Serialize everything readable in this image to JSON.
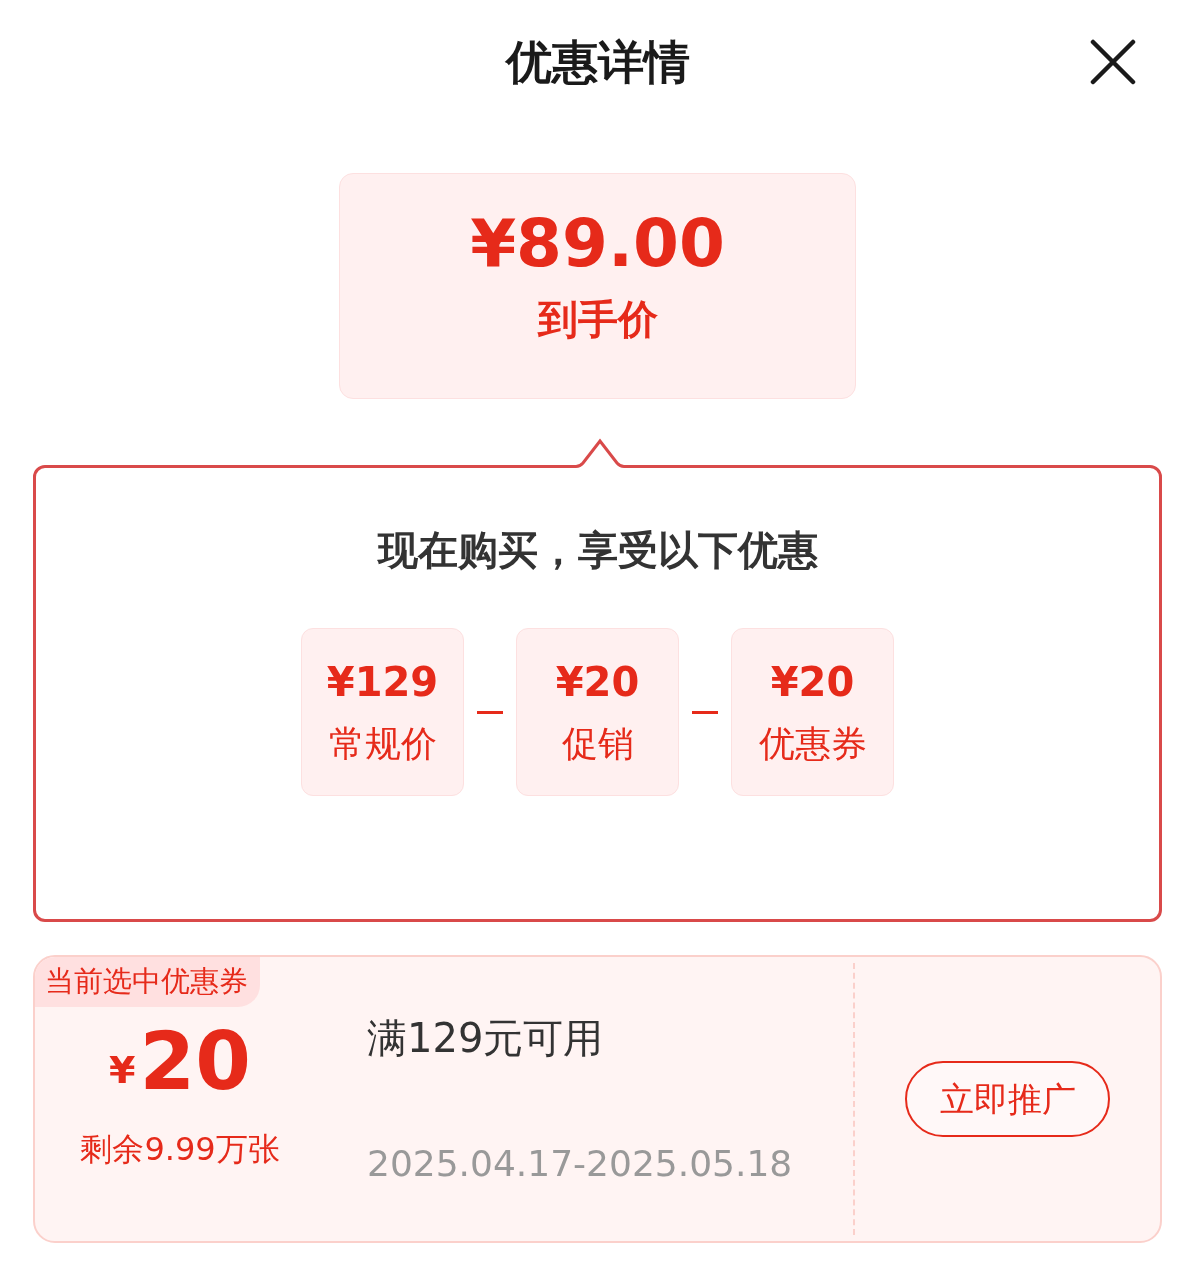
{
  "header": {
    "title": "优惠详情"
  },
  "final_price": {
    "amount": "¥89.00",
    "label": "到手价"
  },
  "breakdown": {
    "heading": "现在购买，享受以下优惠",
    "items": [
      {
        "amount": "¥129",
        "label": "常规价"
      },
      {
        "amount": "¥20",
        "label": "促销"
      },
      {
        "amount": "¥20",
        "label": "优惠券"
      }
    ]
  },
  "coupon": {
    "tag": "当前选中优惠券",
    "currency": "¥",
    "amount": "20",
    "remaining": "剩余9.99万张",
    "condition": "满129元可用",
    "validity": "2025.04.17-2025.05.18",
    "button": "立即推广"
  }
}
